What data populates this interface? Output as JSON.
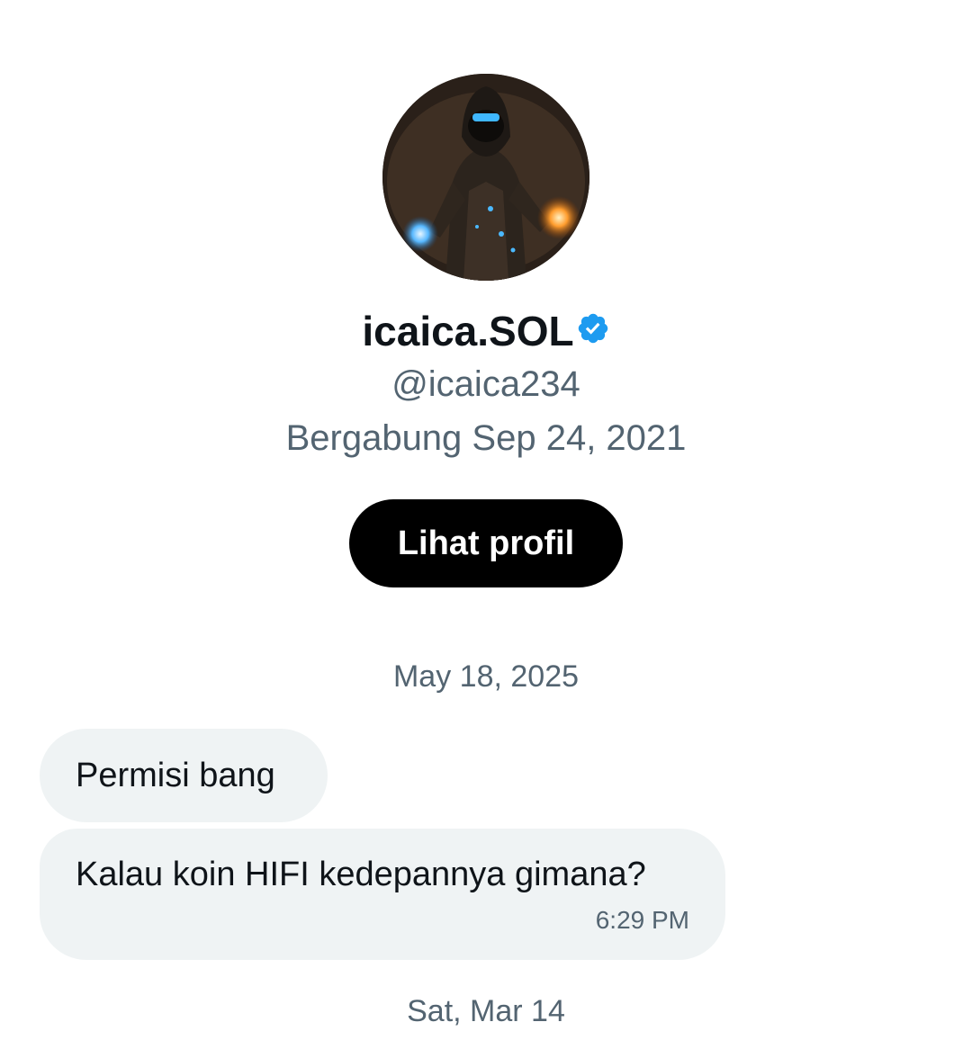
{
  "profile": {
    "avatar_icon": "avatar-hooded-sorcerer",
    "display_name": "icaica.SOL",
    "verified_icon": "verified-badge-icon",
    "handle": "@icaica234",
    "joined": "Bergabung Sep 24, 2021",
    "view_profile_label": "Lihat profil"
  },
  "conversation": {
    "date_separators": [
      "May 18, 2025",
      "Sat, Mar 14"
    ],
    "messages": [
      {
        "text": "Permisi bang"
      },
      {
        "text": "Kalau koin HIFI kedepannya gimana?",
        "time": "6:29 PM"
      }
    ]
  },
  "colors": {
    "verified": "#1d9bf0",
    "button_bg": "#000000",
    "bubble_bg": "#eff3f4",
    "muted_text": "#536471"
  }
}
